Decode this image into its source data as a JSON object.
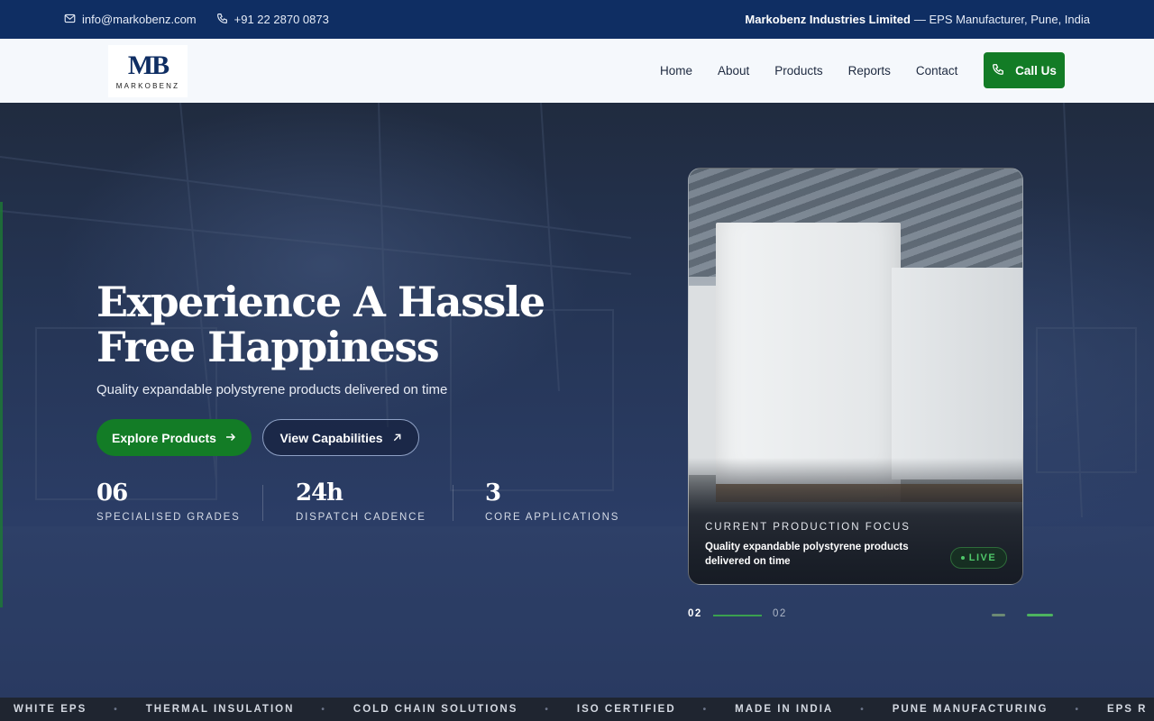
{
  "topbar": {
    "email": "info@markobenz.com",
    "phone": "+91 22 2870 0873",
    "company": "Markobenz Industries Limited",
    "tagline": "— EPS Manufacturer, Pune, India"
  },
  "nav": {
    "logo_text": "MARKOBENZ",
    "logo_mark": "MB",
    "items": [
      "Home",
      "About",
      "Products",
      "Reports",
      "Contact"
    ],
    "cta": "Call Us"
  },
  "hero": {
    "title_line1": "Experience A Hassle",
    "title_line2": "Free Happiness",
    "subtitle": "Quality expandable polystyrene products delivered on time",
    "primary_button": "Explore Products",
    "secondary_button": "View Capabilities",
    "stats": [
      {
        "value": "06",
        "label": "SPECIALISED GRADES"
      },
      {
        "value": "24h",
        "label": "DISPATCH CADENCE"
      },
      {
        "value": "3",
        "label": "CORE APPLICATIONS"
      }
    ]
  },
  "card": {
    "label": "CURRENT PRODUCTION FOCUS",
    "text": "Quality expandable polystyrene products delivered on time",
    "badge": "LIVE"
  },
  "pager": {
    "current": "02",
    "total": "02"
  },
  "ticker": [
    "WHITE EPS",
    "THERMAL INSULATION",
    "COLD CHAIN SOLUTIONS",
    "ISO CERTIFIED",
    "MADE IN INDIA",
    "PUNE MANUFACTURING",
    "EPS R"
  ],
  "colors": {
    "topbar": "#0f2e63",
    "accent_green": "#137c26",
    "nav_bg": "#f5f8fc"
  }
}
